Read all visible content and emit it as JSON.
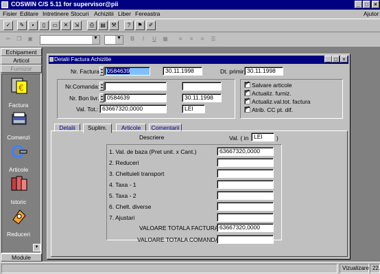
{
  "app": {
    "title": "COSWIN C/S 5.11 for supervisor@pii"
  },
  "menu": {
    "items": [
      "Fisier",
      "Editare",
      "Intretinere",
      "Stocuri",
      "Achizitii",
      "Liber",
      "Fereastra"
    ],
    "help": "Ajutor"
  },
  "sidebar": {
    "tabs": [
      "Echipament",
      "Articol",
      "Furnizor"
    ],
    "items": [
      "Factura",
      "Comenzi",
      "Articole",
      "Istoric",
      "Reduceri"
    ],
    "bottom": "Module"
  },
  "window": {
    "title": "Detalii Factura Achizitie",
    "nr_factura_label": "Nr. Factura:",
    "nr_factura_value": "0584639",
    "date1": "30.11.1998",
    "dt_primirii_label": "Dt. primirii:",
    "dt_primirii_value": "30.11.1998",
    "nr_comanda_label": "Nr.Comanda:",
    "nr_comanda_value": "",
    "nr_bon_label": "Nr. Bon livr.:",
    "nr_bon_value": "0584639",
    "bon_date": "30.11.1998",
    "val_tot_label": "Val. Tot.:",
    "val_tot_value": "63667320,0000",
    "currency": "LEI",
    "checkboxes": [
      "Salvare articole",
      "Actualiz. furniz.",
      "Actualiz.val.tot. factura",
      "Atrib. CC pt. dif."
    ]
  },
  "tabs": [
    "Detalii",
    "Suplim.",
    "Articole",
    "Comentarii"
  ],
  "supl": {
    "descriere_header": "Descriere",
    "val_header": "Val. ( in",
    "val_currency": "LEI",
    "val_close": ")",
    "rows": [
      {
        "label": "1. Val. de baza (Pret unit. x Cant.)",
        "value": "63667320,0000"
      },
      {
        "label": "2. Reduceri",
        "value": ""
      },
      {
        "label": "3. Cheltuieli transport",
        "value": ""
      },
      {
        "label": "4. Taxa - 1",
        "value": ""
      },
      {
        "label": "5. Taxa - 2",
        "value": ""
      },
      {
        "label": "6. Chelt. diverse",
        "value": ""
      },
      {
        "label": "7. Ajustari",
        "value": ""
      },
      {
        "label": "VALOARE TOTALA FACTURA :",
        "value": "63667320,0000"
      },
      {
        "label": "VALOARE TOTALA COMANDA :",
        "value": ""
      }
    ]
  },
  "status": {
    "mode": "Vizualizare",
    "value": "22.0"
  },
  "colors": {
    "titlebar": "#000080",
    "desktop": "#808080",
    "face": "#c0c0c0"
  }
}
